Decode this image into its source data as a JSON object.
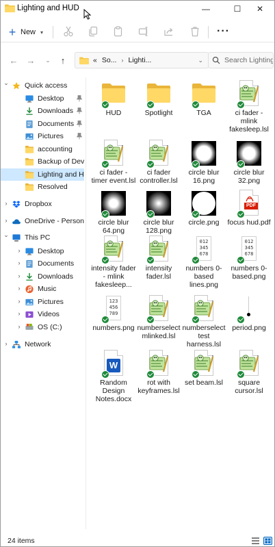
{
  "window": {
    "title": "Lighting and HUD"
  },
  "window_controls": {
    "minimize": "—",
    "maximize": "☐",
    "close": "✕"
  },
  "toolbar": {
    "new_label": "New",
    "more_label": "···"
  },
  "address": {
    "prefix": "«",
    "crumbs": [
      "So...",
      "Lighti..."
    ]
  },
  "search": {
    "placeholder": "Search Lighting a..."
  },
  "nav": {
    "items": [
      {
        "label": "Quick access",
        "icon": "star-icon",
        "indent": 0,
        "chevron": "down",
        "pinned": false,
        "selected": false
      },
      {
        "label": "Desktop",
        "icon": "desktop-icon",
        "indent": 1,
        "chevron": "",
        "pinned": true,
        "selected": false
      },
      {
        "label": "Downloads",
        "icon": "download-icon",
        "indent": 1,
        "chevron": "",
        "pinned": true,
        "selected": false
      },
      {
        "label": "Documents",
        "icon": "documents-icon",
        "indent": 1,
        "chevron": "",
        "pinned": true,
        "selected": false
      },
      {
        "label": "Pictures",
        "icon": "pictures-icon",
        "indent": 1,
        "chevron": "",
        "pinned": true,
        "selected": false
      },
      {
        "label": "accounting",
        "icon": "folder-icon",
        "indent": 1,
        "chevron": "",
        "pinned": false,
        "selected": false
      },
      {
        "label": "Backup of Dev insta",
        "icon": "folder-icon",
        "indent": 1,
        "chevron": "",
        "pinned": false,
        "selected": false
      },
      {
        "label": "Lighting and HUD",
        "icon": "folder-icon",
        "indent": 1,
        "chevron": "",
        "pinned": false,
        "selected": true
      },
      {
        "label": "Resolved",
        "icon": "folder-icon",
        "indent": 1,
        "chevron": "",
        "pinned": false,
        "selected": false
      },
      {
        "label": "Dropbox",
        "icon": "dropbox-icon",
        "indent": 0,
        "chevron": "right",
        "pinned": false,
        "selected": false
      },
      {
        "label": "OneDrive - Personal",
        "icon": "onedrive-icon",
        "indent": 0,
        "chevron": "right",
        "pinned": false,
        "selected": false
      },
      {
        "label": "This PC",
        "icon": "pc-icon",
        "indent": 0,
        "chevron": "down",
        "pinned": false,
        "selected": false
      },
      {
        "label": "Desktop",
        "icon": "desktop-icon",
        "indent": 1,
        "chevron": "right",
        "pinned": false,
        "selected": false
      },
      {
        "label": "Documents",
        "icon": "documents-icon",
        "indent": 1,
        "chevron": "right",
        "pinned": false,
        "selected": false
      },
      {
        "label": "Downloads",
        "icon": "download-icon",
        "indent": 1,
        "chevron": "right",
        "pinned": false,
        "selected": false
      },
      {
        "label": "Music",
        "icon": "music-icon",
        "indent": 1,
        "chevron": "right",
        "pinned": false,
        "selected": false
      },
      {
        "label": "Pictures",
        "icon": "pictures-icon",
        "indent": 1,
        "chevron": "right",
        "pinned": false,
        "selected": false
      },
      {
        "label": "Videos",
        "icon": "videos-icon",
        "indent": 1,
        "chevron": "right",
        "pinned": false,
        "selected": false
      },
      {
        "label": "OS (C:)",
        "icon": "drive-icon",
        "indent": 1,
        "chevron": "right",
        "pinned": false,
        "selected": false
      },
      {
        "label": "Network",
        "icon": "network-icon",
        "indent": 0,
        "chevron": "right",
        "pinned": false,
        "selected": false
      }
    ]
  },
  "files": [
    {
      "name": "HUD",
      "kind": "folder"
    },
    {
      "name": "Spotlight",
      "kind": "folder"
    },
    {
      "name": "TGA",
      "kind": "folder"
    },
    {
      "name": "ci fader - mlink fakesleep.lsl",
      "kind": "lsl"
    },
    {
      "name": "ci fader - timer event.lsl",
      "kind": "lsl"
    },
    {
      "name": "ci fader controller.lsl",
      "kind": "lsl"
    },
    {
      "name": "circle blur 16.png",
      "kind": "blur",
      "softness": 0.1
    },
    {
      "name": "circle blur 32.png",
      "kind": "blur",
      "softness": 0.25
    },
    {
      "name": "circle blur 64.png",
      "kind": "blur",
      "softness": 0.5
    },
    {
      "name": "circle blur 128.png",
      "kind": "blur",
      "softness": 0.9
    },
    {
      "name": "circle.png",
      "kind": "blur",
      "softness": 0
    },
    {
      "name": "focus hud.pdf",
      "kind": "pdf"
    },
    {
      "name": "intensity fader - mlink fakesleep...",
      "kind": "lsl"
    },
    {
      "name": "intensity fader.lsl",
      "kind": "lsl"
    },
    {
      "name": "numbers 0-based lines.png",
      "kind": "nums",
      "digits": "012\n345\n678"
    },
    {
      "name": "numbers 0-based.png",
      "kind": "nums",
      "digits": "012\n345\n678"
    },
    {
      "name": "numbers.png",
      "kind": "nums",
      "digits": "123\n456\n789"
    },
    {
      "name": "numberselect mlinked.lsl",
      "kind": "lsl"
    },
    {
      "name": "numberselect test harness.lsl",
      "kind": "lsl"
    },
    {
      "name": "period.png",
      "kind": "period"
    },
    {
      "name": "Random Design Notes.docx",
      "kind": "docx"
    },
    {
      "name": "rot with keyframes.lsl",
      "kind": "lsl"
    },
    {
      "name": "set beam.lsl",
      "kind": "lsl"
    },
    {
      "name": "square cursor.lsl",
      "kind": "lsl"
    }
  ],
  "file_badges": {
    "pdf": "PDF",
    "docx": "W"
  },
  "status": {
    "count": "24 items"
  },
  "colors": {
    "accent": "#0067c0",
    "folder": "#f4c84a",
    "selected": "#cde8ff",
    "sync_ok": "#1f8a3a"
  }
}
